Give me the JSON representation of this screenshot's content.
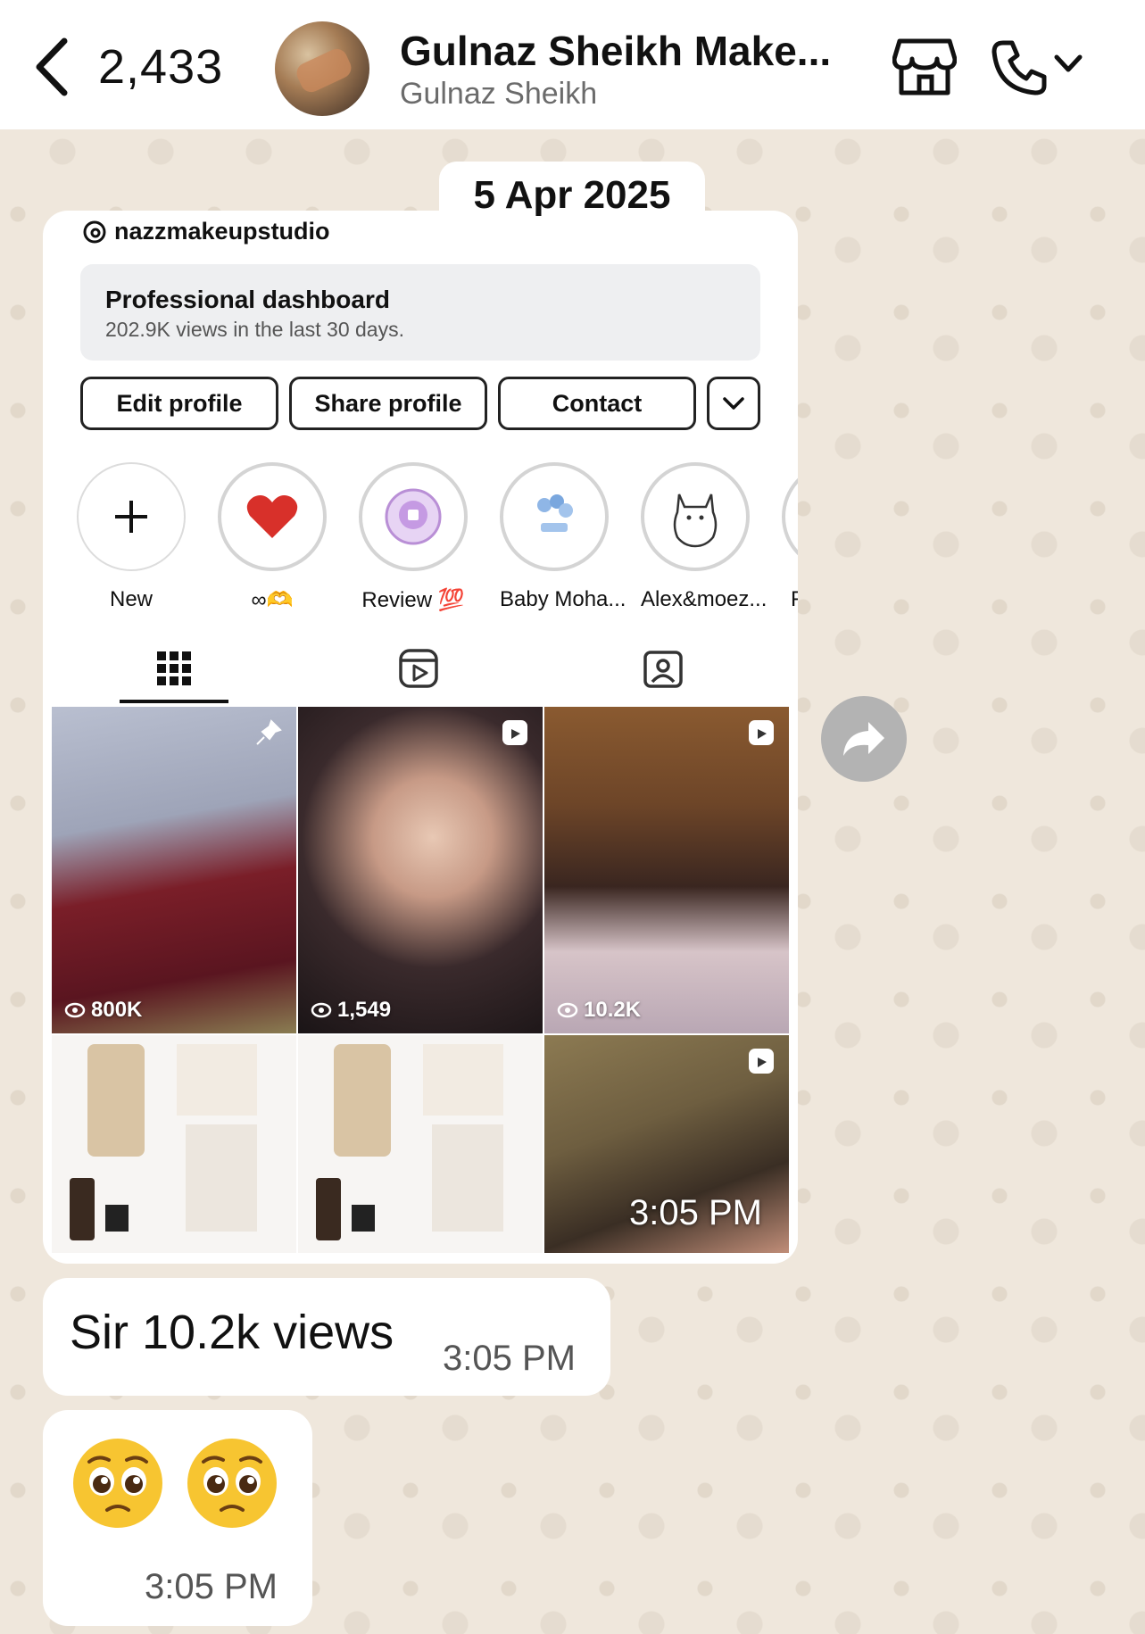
{
  "header": {
    "back_count": "2,433",
    "title": "Gulnaz Sheikh Make...",
    "subtitle": "Gulnaz Sheikh"
  },
  "date_divider": "5 Apr 2025",
  "shared_image": {
    "username": "nazzmakeupstudio",
    "dashboard": {
      "title": "Professional dashboard",
      "subtitle": "202.9K views in the last 30 days."
    },
    "buttons": {
      "edit": "Edit profile",
      "share": "Share profile",
      "contact": "Contact"
    },
    "highlights": [
      {
        "label": "New"
      },
      {
        "label": "∞🫶"
      },
      {
        "label": "Review 💯"
      },
      {
        "label": "Baby Moha..."
      },
      {
        "label": "Alex&moez..."
      },
      {
        "label": "F("
      }
    ],
    "tiles": [
      {
        "count": "800K"
      },
      {
        "count": "1,549"
      },
      {
        "count": "10.2K"
      }
    ],
    "time": "3:05 PM"
  },
  "messages": [
    {
      "text": "Sir 10.2k views",
      "time": "3:05 PM"
    },
    {
      "text": "",
      "time": "3:05 PM"
    }
  ],
  "colors": {
    "bubble": "#ffffff",
    "wallpaper": "#efe7dc",
    "forward": "#b3b3b3"
  }
}
